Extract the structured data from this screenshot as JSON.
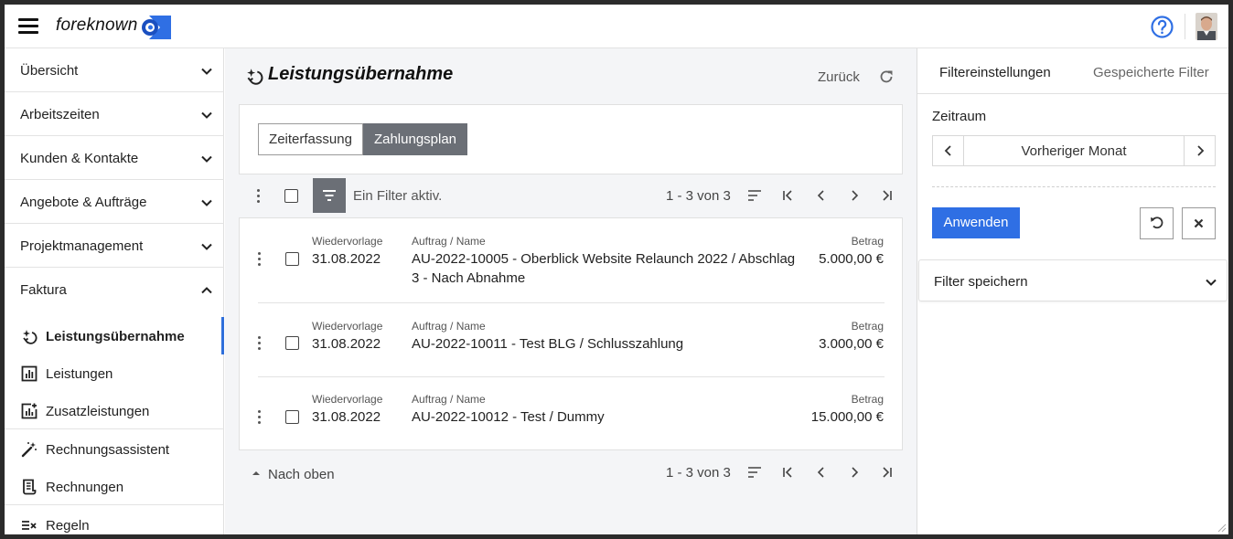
{
  "app": {
    "logo_text": "foreknown",
    "brand_color": "#2f6fe4"
  },
  "sidebar": {
    "sections": [
      {
        "label": "Übersicht",
        "expanded": false
      },
      {
        "label": "Arbeitszeiten",
        "expanded": false
      },
      {
        "label": "Kunden & Kontakte",
        "expanded": false
      },
      {
        "label": "Angebote & Aufträge",
        "expanded": false
      },
      {
        "label": "Projektmanagement",
        "expanded": false
      },
      {
        "label": "Faktura",
        "expanded": true
      }
    ],
    "faktura_items": [
      {
        "label": "Leistungsübernahme",
        "icon": "sparkle-icon",
        "active": true
      },
      {
        "label": "Leistungen",
        "icon": "bar-chart-icon",
        "active": false
      },
      {
        "label": "Zusatzleistungen",
        "icon": "chart-plus-icon",
        "active": false
      },
      {
        "label": "Rechnungsassistent",
        "icon": "magic-wand-icon",
        "active": false
      },
      {
        "label": "Rechnungen",
        "icon": "invoice-icon",
        "active": false
      },
      {
        "label": "Regeln",
        "icon": "rules-icon",
        "active": false
      }
    ]
  },
  "main": {
    "title": "Leistungsübernahme",
    "back_label": "Zurück",
    "tabs": [
      {
        "label": "Zeiterfassung",
        "active": false
      },
      {
        "label": "Zahlungsplan",
        "active": true
      }
    ],
    "filter_status": "Ein Filter aktiv.",
    "pager_text": "1 - 3 von 3",
    "columns": {
      "date": "Wiedervorlage",
      "name": "Auftrag / Name",
      "amount": "Betrag"
    },
    "rows": [
      {
        "date": "31.08.2022",
        "name": "AU-2022-10005 - Oberblick Website Relaunch 2022 / Abschlag 3 - Nach Abnahme",
        "amount": "5.000,00 €"
      },
      {
        "date": "31.08.2022",
        "name": "AU-2022-10011 - Test BLG / Schlusszahlung",
        "amount": "3.000,00 €"
      },
      {
        "date": "31.08.2022",
        "name": "AU-2022-10012 - Test / Dummy",
        "amount": "15.000,00 €"
      }
    ],
    "to_top_label": "Nach oben"
  },
  "filter_panel": {
    "tab_settings": "Filtereinstellungen",
    "tab_saved": "Gespeicherte Filter",
    "period_label": "Zeitraum",
    "period_value": "Vorheriger Monat",
    "apply_label": "Anwenden",
    "save_filter_label": "Filter speichern"
  }
}
